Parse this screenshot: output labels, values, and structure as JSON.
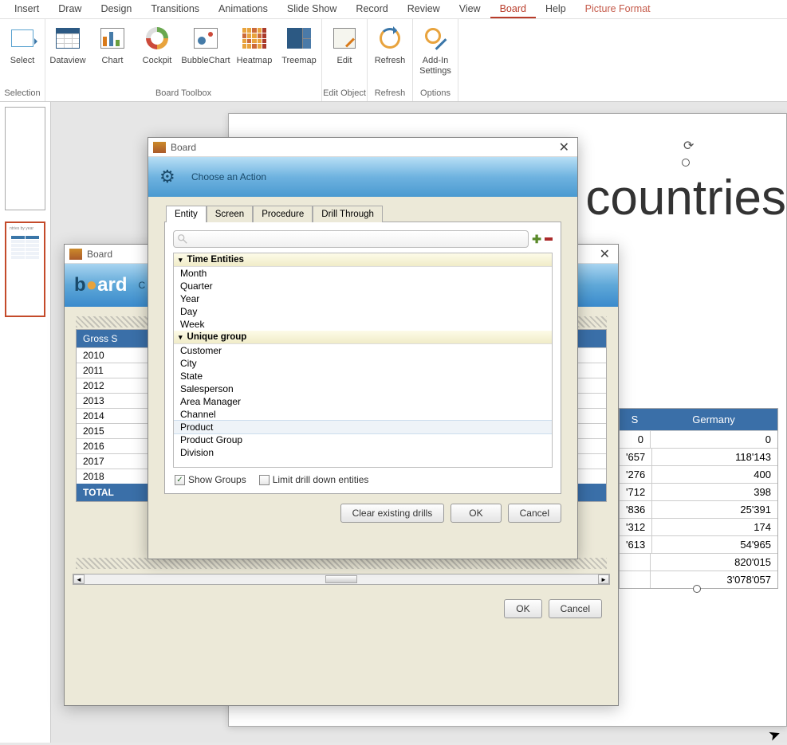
{
  "ribbon": {
    "tabs": [
      "Insert",
      "Draw",
      "Design",
      "Transitions",
      "Animations",
      "Slide Show",
      "Record",
      "Review",
      "View",
      "Board",
      "Help",
      "Picture Format"
    ],
    "active": "Board",
    "contextual": "Picture Format",
    "groups": {
      "selection": {
        "label": "Selection",
        "select": "Select"
      },
      "toolbox": {
        "label": "Board Toolbox",
        "dataview": "Dataview",
        "chart": "Chart",
        "cockpit": "Cockpit",
        "bubble": "BubbleChart",
        "heatmap": "Heatmap",
        "treemap": "Treemap"
      },
      "editobj": {
        "label": "Edit Object",
        "edit": "Edit"
      },
      "refresh": {
        "label": "Refresh",
        "refresh": "Refresh"
      },
      "options": {
        "label": "Options",
        "settings": "Add-In Settings"
      }
    }
  },
  "slide": {
    "title": "f countries"
  },
  "thumb_caption": "ntries by year",
  "outer_dialog": {
    "title": "Board",
    "logo_c": "C",
    "ok": "OK",
    "cancel": "Cancel"
  },
  "back_table": {
    "header": "Gross S",
    "years": [
      "2010",
      "2011",
      "2012",
      "2013",
      "2014",
      "2015",
      "2016",
      "2017",
      "2018"
    ],
    "total": "TOTAL"
  },
  "inner_dialog": {
    "title": "Board",
    "banner": "Choose an Action",
    "tabs": [
      "Entity",
      "Screen",
      "Procedure",
      "Drill Through"
    ],
    "active_tab": "Entity",
    "search_placeholder": "",
    "groups": [
      {
        "name": "Time Entities",
        "items": [
          "Month",
          "Quarter",
          "Year",
          "Day",
          "Week"
        ]
      },
      {
        "name": "Unique group",
        "items": [
          "Customer",
          "City",
          "State",
          "Salesperson",
          "Area Manager",
          "Channel",
          "Product",
          "Product Group",
          "Division"
        ]
      }
    ],
    "hovered_item": "Product",
    "show_groups": "Show Groups",
    "limit_drill": "Limit drill down entities",
    "clear": "Clear existing drills",
    "ok": "OK",
    "cancel": "Cancel"
  },
  "right_table": {
    "header": "Germany",
    "partial_col_header": "S",
    "rows": [
      [
        "0",
        "0"
      ],
      [
        "'657",
        "118'143"
      ],
      [
        "'276",
        "400"
      ],
      [
        "'712",
        "398"
      ],
      [
        "'836",
        "25'391"
      ],
      [
        "'312",
        "174"
      ],
      [
        "'613",
        "54'965"
      ],
      [
        "",
        "820'015"
      ],
      [
        "",
        "3'078'057"
      ]
    ]
  }
}
